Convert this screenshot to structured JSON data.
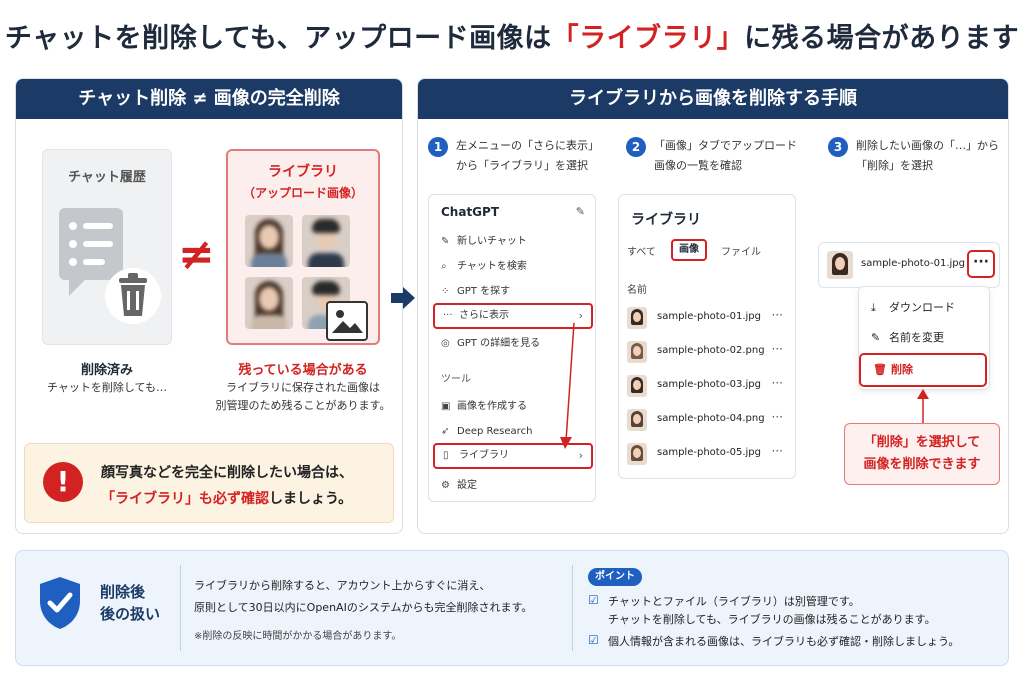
{
  "title": {
    "part1": "チャットを削除しても、アップロード画像は",
    "red": "「ライブラリ」",
    "part2": "に残る場合があります"
  },
  "left_panel": {
    "header": "チャット削除 ≠ 画像の完全削除",
    "chat_card_label": "チャット履歴",
    "neq_symbol": "≠",
    "library_label": "ライブラリ",
    "library_sublabel": "（アップロード画像）",
    "deleted_title": "削除済み",
    "deleted_text": "チャットを削除しても…",
    "remains_title": "残っている場合がある",
    "remains_text1": "ライブラリに保存された画像は",
    "remains_text2": "別管理のため残ることがあります。",
    "warning_line1": "顔写真などを完全に削除したい場合は、",
    "warning_red": "「ライブラリ」も必ず確認",
    "warning_rest": "しましょう。"
  },
  "right_panel": {
    "header": "ライブラリから画像を削除する手順",
    "steps": [
      {
        "num": "1",
        "line1": "左メニューの「さらに表示」",
        "line2": "から「ライブラリ」を選択"
      },
      {
        "num": "2",
        "line1": "「画像」タブでアップロード",
        "line2": "画像の一覧を確認"
      },
      {
        "num": "3",
        "line1": "削除したい画像の「…」から",
        "line2": "「削除」を選択"
      }
    ],
    "menu": {
      "app_name": "ChatGPT",
      "items": [
        "新しいチャット",
        "チャットを検索",
        "GPT を探す",
        "さらに表示",
        "GPT の詳細を見る"
      ],
      "section": "ツール",
      "tools": [
        "画像を作成する",
        "Deep Research",
        "ライブラリ",
        "設定"
      ]
    },
    "library": {
      "title": "ライブラリ",
      "tabs": [
        "すべて",
        "画像",
        "ファイル"
      ],
      "name_header": "名前",
      "files": [
        "sample-photo-01.jpg",
        "sample-photo-02.png",
        "sample-photo-03.jpg",
        "sample-photo-04.png",
        "sample-photo-05.jpg"
      ]
    },
    "selected_file": "sample-photo-01.jpg",
    "context_menu": [
      "ダウンロード",
      "名前を変更",
      "削除"
    ],
    "note_line1": "「削除」を選択して",
    "note_line2": "画像を削除できます"
  },
  "bottom": {
    "label_line1": "削除後",
    "label_line2": "後の扱い",
    "text1": "ライブラリから削除すると、アカウント上からすぐに消え、",
    "text2": "原則として30日以内にOpenAIのシステムからも完全削除されます。",
    "note": "※削除の反映に時間がかかる場合があります。",
    "point_badge": "ポイント",
    "point1a": "チャットとファイル（ライブラリ）は別管理です。",
    "point1b": "チャットを削除しても、ライブラリの画像は残ることがあります。",
    "point2": "個人情報が含まれる画像は、ライブラリも必ず確認・削除しましょう。"
  },
  "colors": {
    "navy": "#1b3a66",
    "red": "#d32222",
    "blue": "#1f5fbf"
  }
}
